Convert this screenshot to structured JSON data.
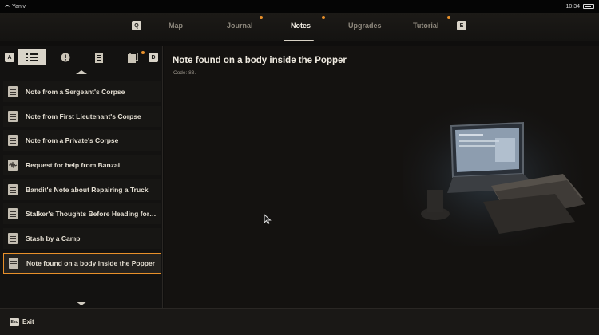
{
  "status": {
    "user": "Yaniv",
    "time": "10:34"
  },
  "nav": {
    "left_key": "Q",
    "right_key": "E",
    "tabs": [
      {
        "label": "Map",
        "active": false,
        "dot": false
      },
      {
        "label": "Journal",
        "active": false,
        "dot": true
      },
      {
        "label": "Notes",
        "active": true,
        "dot": true
      },
      {
        "label": "Upgrades",
        "active": false,
        "dot": false
      },
      {
        "label": "Tutorial",
        "active": false,
        "dot": true
      }
    ]
  },
  "filters": {
    "left_key": "A",
    "right_key": "D",
    "icons": [
      "list-icon",
      "exclamation-icon",
      "document-icon",
      "photo-stack-icon"
    ]
  },
  "notes": [
    {
      "label": "Note from a Sergeant's Corpse",
      "icon": "note-icon"
    },
    {
      "label": "Note from First Lieutenant's Corpse",
      "icon": "note-icon"
    },
    {
      "label": "Note from a Private's Corpse",
      "icon": "note-icon"
    },
    {
      "label": "Request for help from Banzai",
      "icon": "audio-note-icon"
    },
    {
      "label": "Bandit's Note about Repairing a Truck",
      "icon": "note-icon"
    },
    {
      "label": "Stalker's Thoughts Before Heading for the...",
      "icon": "note-icon"
    },
    {
      "label": "Stash by a Camp",
      "icon": "note-icon"
    },
    {
      "label": "Note found on a body inside the Popper",
      "icon": "note-icon",
      "selected": true
    }
  ],
  "detail": {
    "title": "Note found on a body inside the Popper",
    "code": "Code: 83."
  },
  "bottom": {
    "esc_key": "Esc",
    "exit_label": "Exit"
  },
  "colors": {
    "accent": "#e8902a",
    "background": "#141210",
    "text": "#f0ebe1"
  }
}
